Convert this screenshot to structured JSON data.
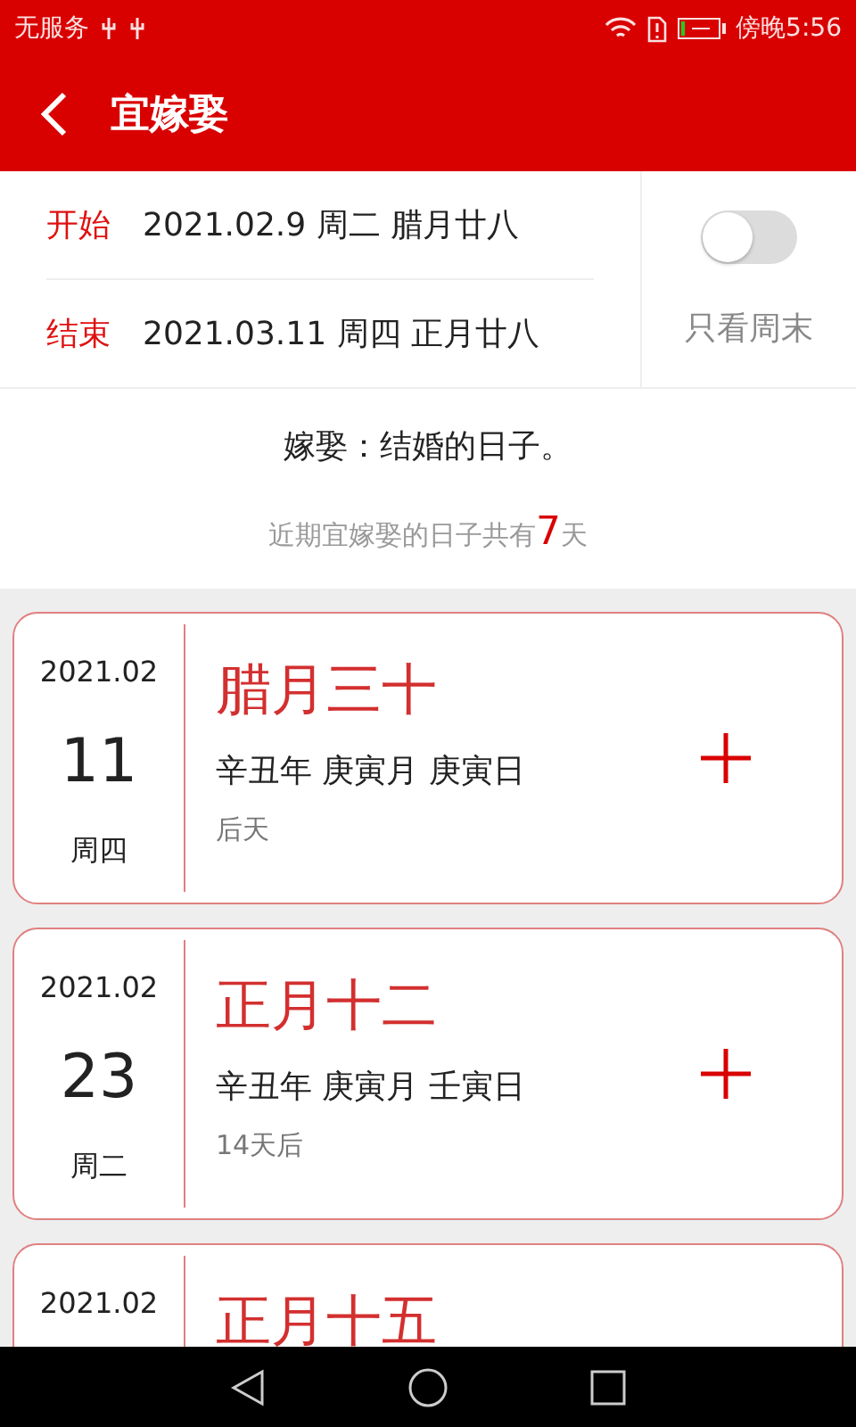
{
  "status_bar": {
    "carrier": "无服务",
    "time": "傍晚5:56"
  },
  "header": {
    "title": "宜嫁娶"
  },
  "range": {
    "start_label": "开始",
    "start_value": "2021.02.9 周二 腊月廿八",
    "end_label": "结束",
    "end_value": "2021.03.11 周四 正月廿八",
    "weekend_only": {
      "label": "只看周末",
      "on": false
    }
  },
  "description": "嫁娶：结婚的日子。",
  "summary": {
    "prefix": "近期宜嫁娶的日子共有",
    "count": "7",
    "suffix": "天"
  },
  "days": [
    {
      "month": "2021.02",
      "day": "11",
      "weekday": "周四",
      "lunar": "腊月三十",
      "ganzhi": "辛丑年 庚寅月 庚寅日",
      "relative": "后天"
    },
    {
      "month": "2021.02",
      "day": "23",
      "weekday": "周二",
      "lunar": "正月十二",
      "ganzhi": "辛丑年 庚寅月 壬寅日",
      "relative": "14天后"
    },
    {
      "month": "2021.02",
      "lunar": "正月十五"
    }
  ]
}
